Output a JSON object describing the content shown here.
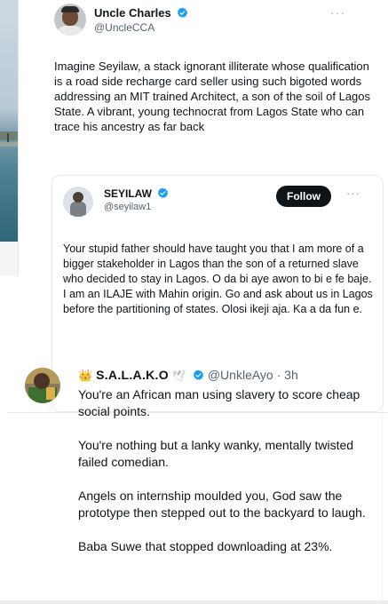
{
  "tweet": {
    "author_name": "Uncle Charles",
    "author_handle": "@UncleCCA",
    "more_label": "···",
    "text": "Imagine Seyilaw, a stack ignorant illiterate whose qualification is a road side recharge card seller using such bigoted words addressing an MIT trained Architect, a son of the soil of Lagos State. A vibrant, young technocrat from Lagos State who can trace his ancestry as far back",
    "verified_color": "#1d9bf0"
  },
  "quote": {
    "author_name": "SEYILAW",
    "author_handle": "@seyilaw1",
    "follow_label": "Follow",
    "more_label": "···",
    "text": "Your stupid father should have taught you that I am more of a bigger stakeholder in Lagos than the son of a returned slave who decided to stay in Lagos. O da bi aye awon to bi e fe baje. I am an ILAJE with Mahin origin. Go and ask about us in Lagos before the partitioning of states. Olosi ikeji aja. Ka a da fun e."
  },
  "reply": {
    "crown": "👑",
    "author_name": "S.A.L.A.K.O",
    "dove": "🕊",
    "author_handle": "@UnkleAyo",
    "time": "· 3h",
    "paragraphs": [
      "You're an African man using slavery to score cheap social points.",
      "You're nothing but a lanky wanky, mentally twisted failed comedian.",
      "Angels on internship moulded you, God saw the prototype then stepped out to the backyard to laugh.",
      "Baba Suwe that stopped downloading at 23%."
    ]
  }
}
